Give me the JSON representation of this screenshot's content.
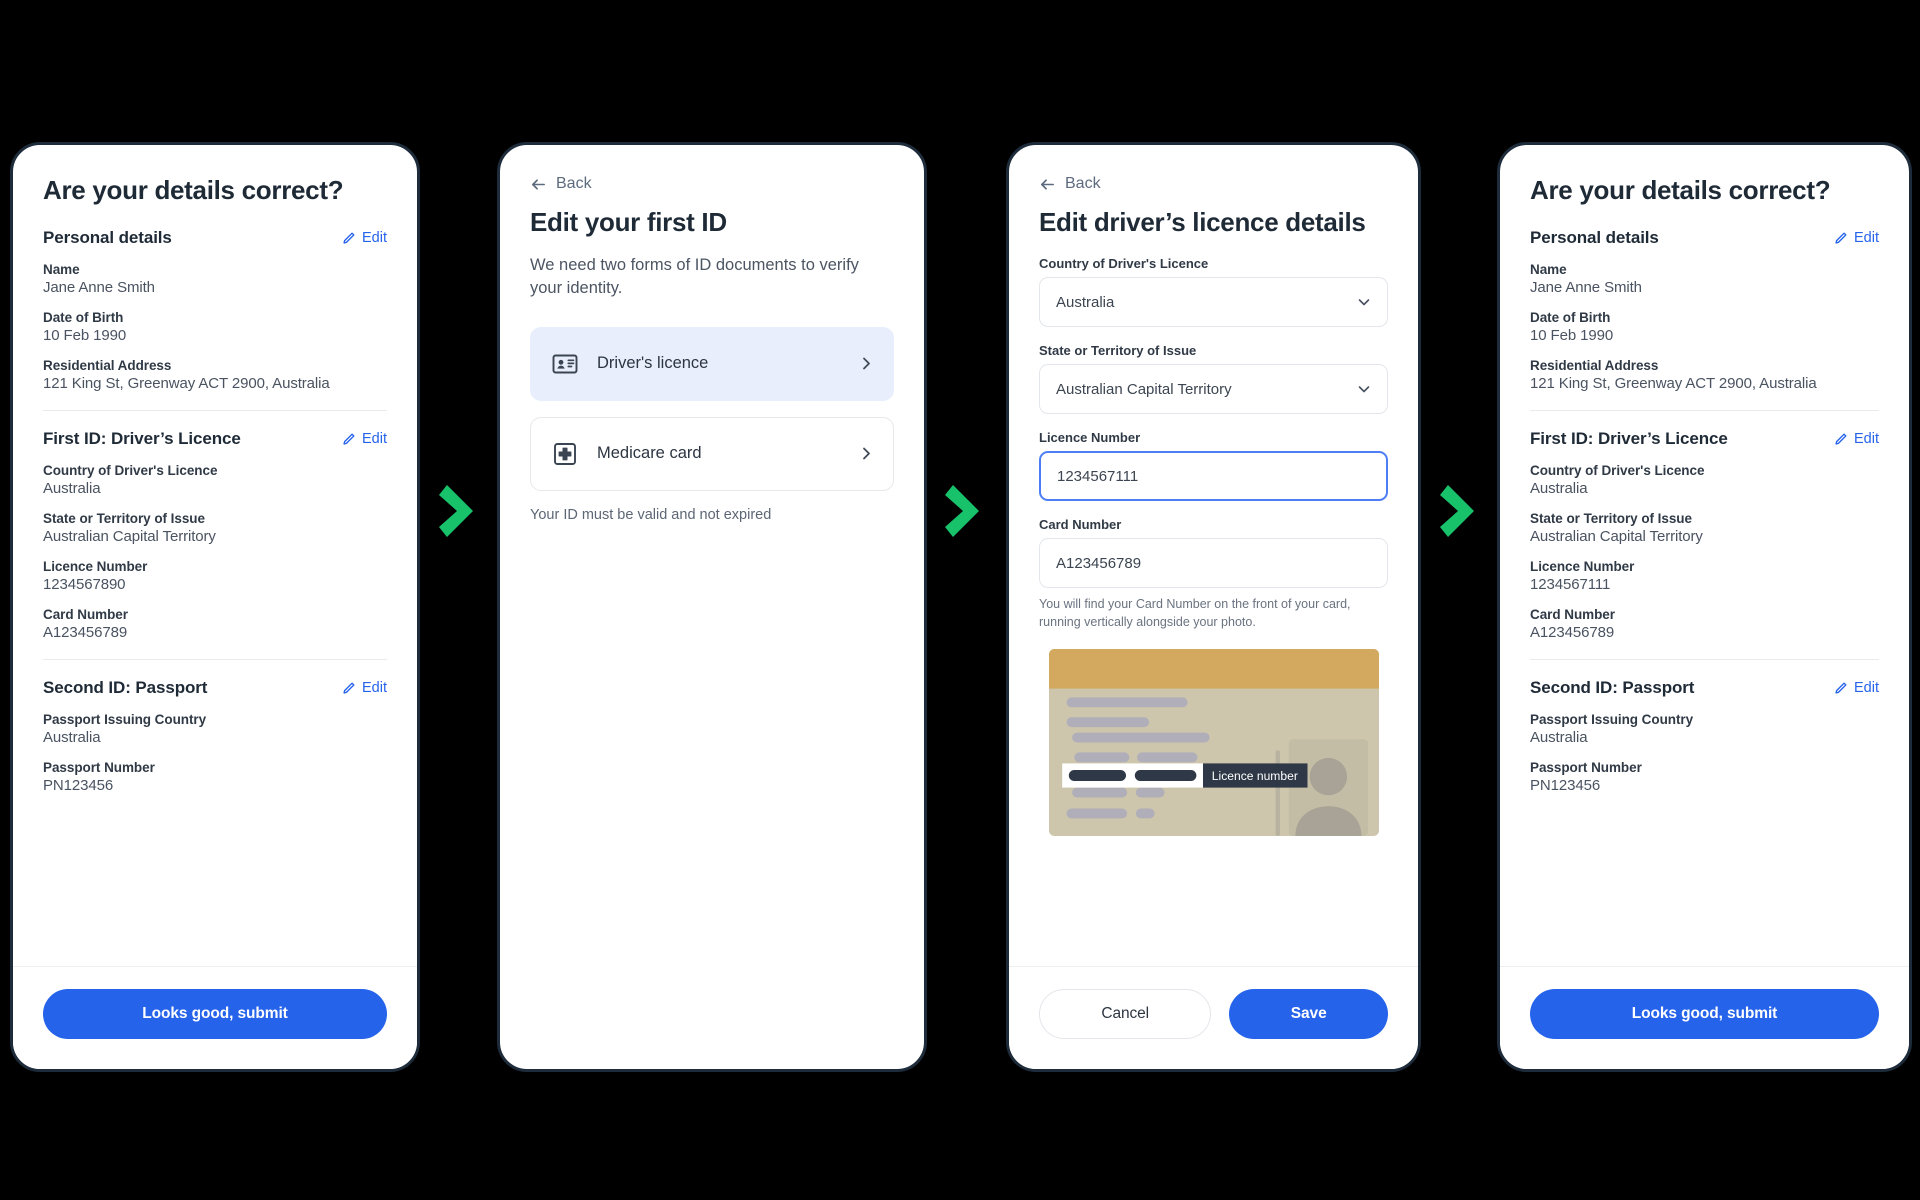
{
  "theme": {
    "background": "#000000",
    "accent_blue": "#2563EB",
    "arrow_green": "#18C26B",
    "text_dark": "#1F2A37",
    "selected_option_bg": "#E8EEFC"
  },
  "arrows": {
    "icon": "chevron-right-arrow",
    "count": 3
  },
  "panel_1": {
    "title": "Are your details correct?",
    "sections": [
      {
        "heading": "Personal details",
        "edit_label": "Edit",
        "fields": [
          {
            "label": "Name",
            "value": "Jane Anne Smith"
          },
          {
            "label": "Date of Birth",
            "value": "10 Feb 1990"
          },
          {
            "label": "Residential Address",
            "value": "121 King St, Greenway ACT 2900, Australia"
          }
        ]
      },
      {
        "heading": "First ID: Driver’s Licence",
        "edit_label": "Edit",
        "fields": [
          {
            "label": "Country of Driver's Licence",
            "value": "Australia"
          },
          {
            "label": "State or Territory of Issue",
            "value": "Australian Capital Territory"
          },
          {
            "label": "Licence Number",
            "value": "1234567890"
          },
          {
            "label": "Card Number",
            "value": "A123456789"
          }
        ]
      },
      {
        "heading": "Second ID: Passport",
        "edit_label": "Edit",
        "fields": [
          {
            "label": "Passport Issuing Country",
            "value": "Australia"
          },
          {
            "label": "Passport Number",
            "value": "PN123456"
          }
        ]
      }
    ],
    "submit_label": "Looks good, submit"
  },
  "panel_2": {
    "back_label": "Back",
    "title": "Edit your first ID",
    "lede": "We need two forms of ID documents to verify your identity.",
    "options": [
      {
        "label": "Driver's licence",
        "icon": "id-card-icon",
        "selected": true
      },
      {
        "label": "Medicare card",
        "icon": "medical-cross-icon",
        "selected": false
      }
    ],
    "helper_note": "Your ID must be valid and not expired"
  },
  "panel_3": {
    "back_label": "Back",
    "title": "Edit driver’s licence details",
    "fields": [
      {
        "label": "Country of Driver's Licence",
        "value": "Australia",
        "type": "select",
        "focused": false
      },
      {
        "label": "State or Territory of Issue",
        "value": "Australian Capital Territory",
        "type": "select",
        "focused": false
      },
      {
        "label": "Licence Number",
        "value": "1234567111",
        "type": "text",
        "focused": true
      },
      {
        "label": "Card Number",
        "value": "A123456789",
        "type": "text",
        "focused": false,
        "hint": "You will find your Card Number on the front of your card, running vertically alongside your photo."
      }
    ],
    "illustration": {
      "name": "drivers-licence-card-illustration",
      "callout_label": "Licence number"
    },
    "cancel_label": "Cancel",
    "save_label": "Save"
  },
  "panel_4": {
    "title": "Are your details correct?",
    "sections": [
      {
        "heading": "Personal details",
        "edit_label": "Edit",
        "fields": [
          {
            "label": "Name",
            "value": "Jane Anne Smith"
          },
          {
            "label": "Date of Birth",
            "value": "10 Feb 1990"
          },
          {
            "label": "Residential Address",
            "value": "121 King St, Greenway ACT 2900, Australia"
          }
        ]
      },
      {
        "heading": "First ID: Driver’s Licence",
        "edit_label": "Edit",
        "fields": [
          {
            "label": "Country of Driver's Licence",
            "value": "Australia"
          },
          {
            "label": "State or Territory of Issue",
            "value": "Australian Capital Territory"
          },
          {
            "label": "Licence Number",
            "value": "1234567111"
          },
          {
            "label": "Card Number",
            "value": "A123456789"
          }
        ]
      },
      {
        "heading": "Second ID: Passport",
        "edit_label": "Edit",
        "fields": [
          {
            "label": "Passport Issuing Country",
            "value": "Australia"
          },
          {
            "label": "Passport Number",
            "value": "PN123456"
          }
        ]
      }
    ],
    "submit_label": "Looks good, submit"
  }
}
